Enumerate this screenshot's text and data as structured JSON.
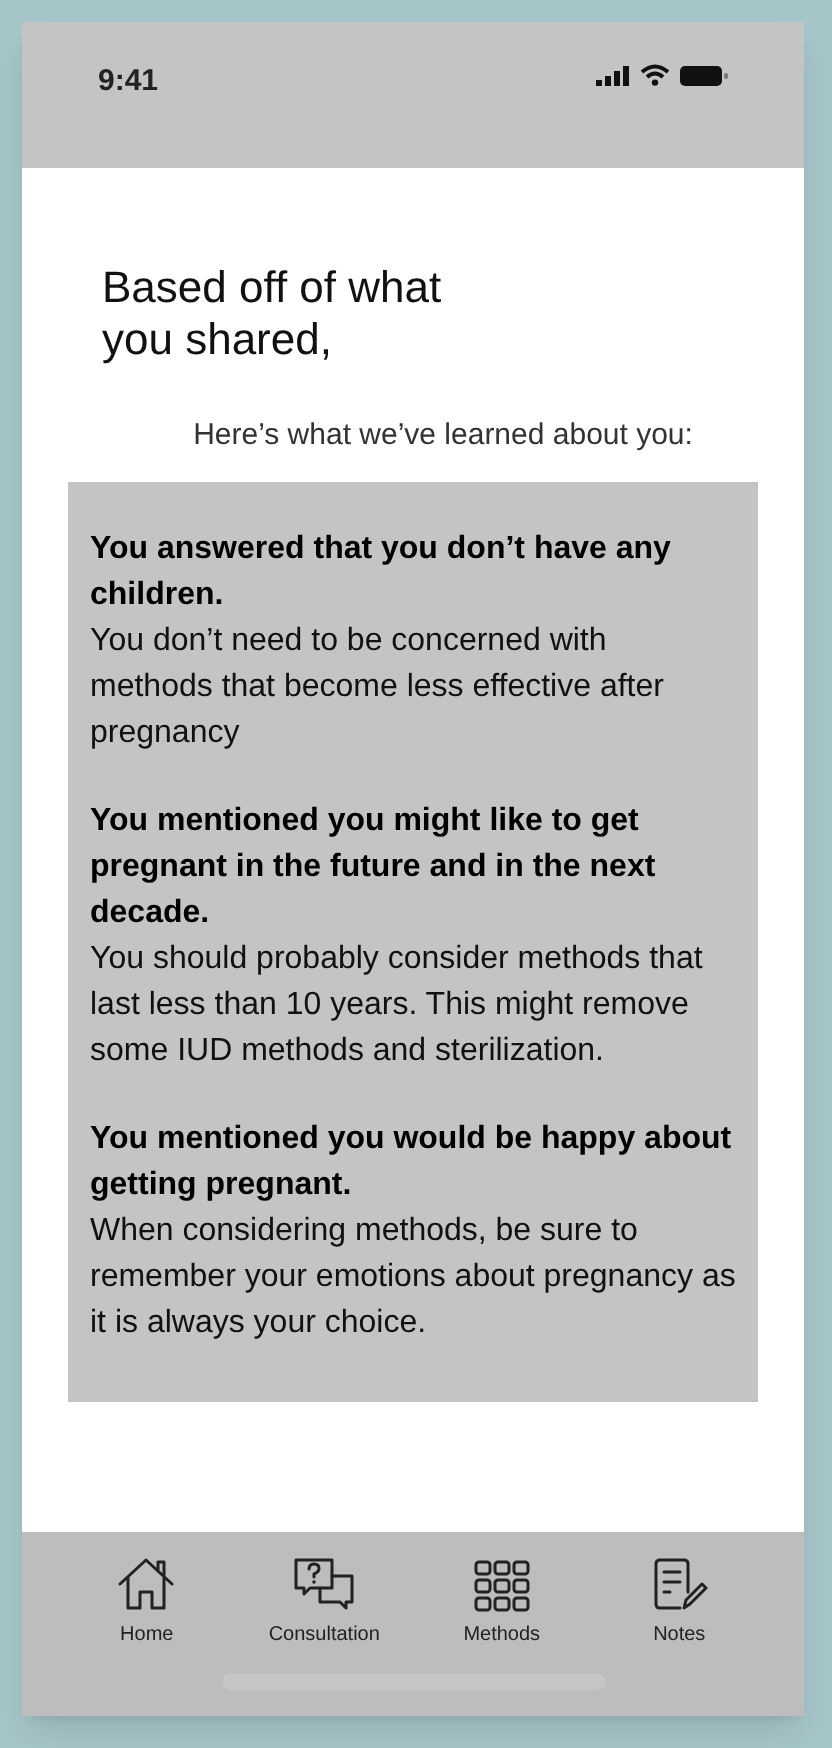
{
  "status_bar": {
    "time": "9:41"
  },
  "heading": "Based off of what you shared,",
  "subheading": "Here’s what we’ve learned about you:",
  "findings": [
    {
      "title": "You answered that you don’t have any children.",
      "body": "You don’t need to be concerned with methods that become less effective after pregnancy"
    },
    {
      "title": "You mentioned you might like to get pregnant in the future and in the next decade.",
      "body": "You should probably consider methods that last less than 10 years. This might remove some IUD methods and sterilization."
    },
    {
      "title": "You mentioned you would be happy about getting pregnant.",
      "body": "When considering methods, be sure to remember your emotions about pregnancy as it is always your choice."
    }
  ],
  "nav": [
    {
      "kind": "home",
      "label": "Home"
    },
    {
      "kind": "consultation",
      "label": "Consultation"
    },
    {
      "kind": "methods",
      "label": "Methods"
    },
    {
      "kind": "notes",
      "label": "Notes"
    }
  ]
}
